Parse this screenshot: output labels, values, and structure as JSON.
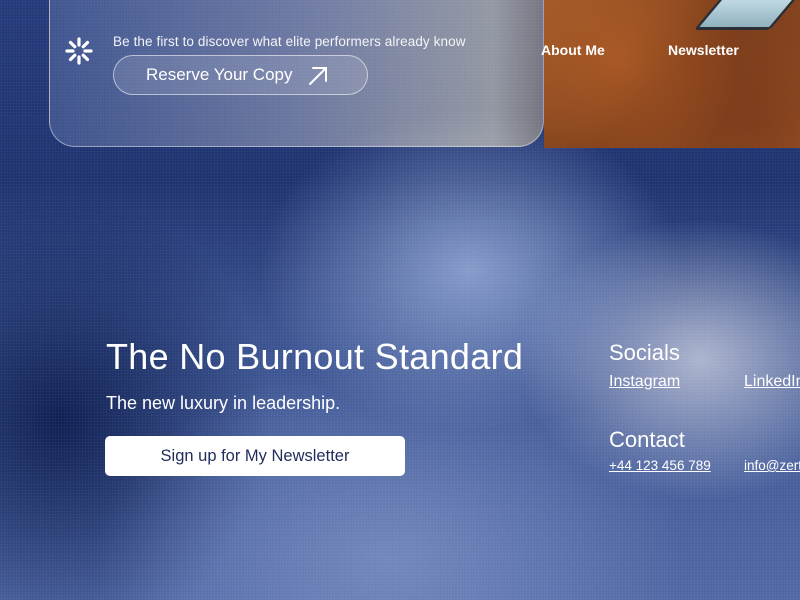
{
  "banner": {
    "tagline": "Be the first to discover what elite performers already know",
    "reserve_label": "Reserve Your Copy"
  },
  "nav": {
    "items": [
      {
        "label": "About Me"
      },
      {
        "label": "Newsletter"
      }
    ]
  },
  "hero": {
    "title": "The No Burnout Standard",
    "subtitle": "The new luxury in leadership.",
    "cta_label": "Sign up for My Newsletter"
  },
  "socials": {
    "heading": "Socials",
    "links": [
      {
        "label": "Instagram"
      },
      {
        "label": "LinkedIn"
      }
    ]
  },
  "contact": {
    "heading": "Contact",
    "phone": "+44 123 456 789",
    "email": "info@zert"
  },
  "icons": {
    "logo": "starburst-logo-icon",
    "arrow": "arrow-up-right-icon"
  },
  "colors": {
    "background_dark": "#1e3370",
    "background_light": "#8fa3d0",
    "button_text": "#1f2c5a",
    "photo_accent": "#9a5427"
  }
}
